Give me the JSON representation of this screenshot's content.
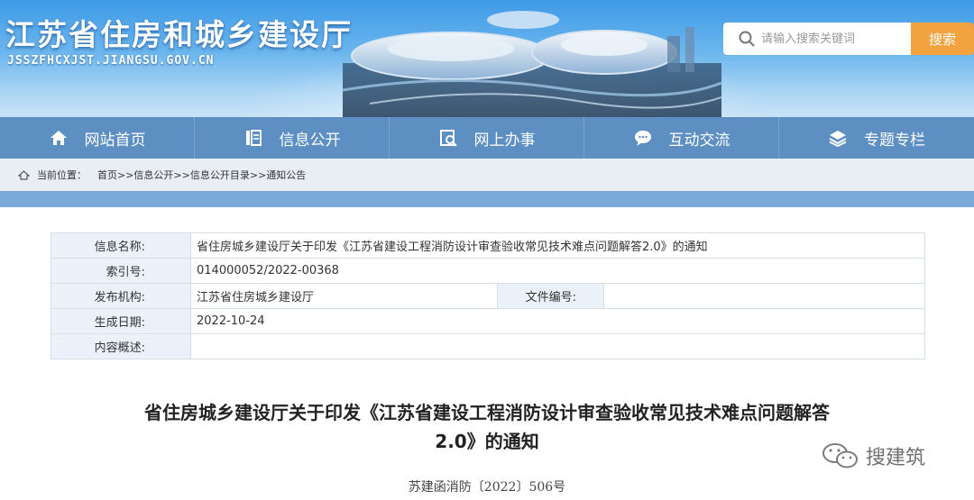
{
  "header": {
    "site_title": "江苏省住房和城乡建设厅",
    "site_domain": "JSSZFHCXJST.JIANGSU.GOV.CN",
    "search": {
      "placeholder": "请输入搜索关键词",
      "button_label": "搜索"
    }
  },
  "nav": {
    "items": [
      {
        "label": "网站首页",
        "icon": "home-icon"
      },
      {
        "label": "信息公开",
        "icon": "document-list-icon"
      },
      {
        "label": "网上办事",
        "icon": "online-service-icon"
      },
      {
        "label": "互动交流",
        "icon": "chat-bubble-icon"
      },
      {
        "label": "专题专栏",
        "icon": "layers-icon"
      }
    ]
  },
  "breadcrumb": {
    "label": "当前位置：",
    "path": "首页>>信息公开>>信息公开目录>>通知公告"
  },
  "info": {
    "name_label": "信息名称:",
    "name_value": "省住房城乡建设厅关于印发《江苏省建设工程消防设计审查验收常见技术难点问题解答2.0》的通知",
    "index_label": "索引号:",
    "index_value": "014000052/2022-00368",
    "publisher_label": "发布机构:",
    "publisher_value": "江苏省住房城乡建设厅",
    "file_no_label": "文件编号:",
    "file_no_value": "",
    "date_label": "生成日期:",
    "date_value": "2022-10-24",
    "summary_label": "内容概述:",
    "summary_value": ""
  },
  "article": {
    "title_line1": "省住房城乡建设厅关于印发《江苏省建设工程消防设计审查验收常见技术难点问题解答",
    "title_line2": "2.0》的通知",
    "doc_number": "苏建函消防〔2022〕506号"
  },
  "watermark": {
    "text": "搜建筑",
    "icon": "wechat-logo"
  },
  "colors": {
    "header_blue": "#3e9ae6",
    "nav_blue": "#5d8fc3",
    "search_orange": "#f2a340",
    "table_label_bg": "#eaf1f9"
  }
}
